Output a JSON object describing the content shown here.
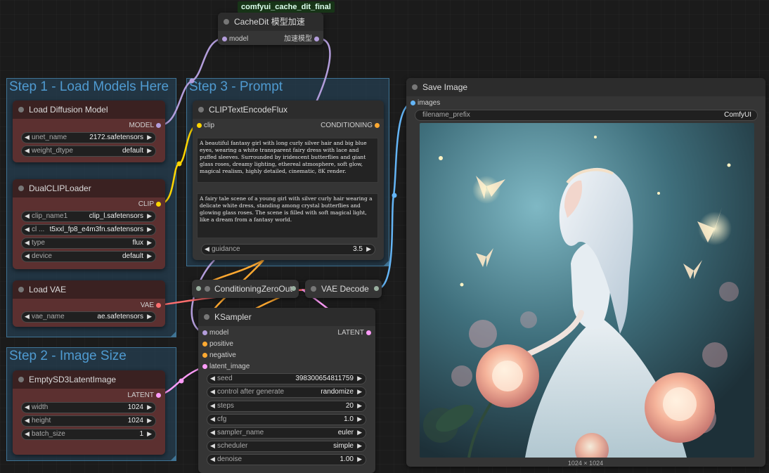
{
  "badge": "comfyui_cache_dit_final",
  "groups": {
    "step1": "Step 1 - Load Models Here",
    "step2": "Step 2 - Image Size",
    "step3": "Step 3 - Prompt"
  },
  "cachedit": {
    "title": "CacheDit 模型加速",
    "input": "model",
    "output": "加速模型"
  },
  "load_diffusion": {
    "title": "Load Diffusion Model",
    "output": "MODEL",
    "widgets": [
      {
        "label": "unet_name",
        "value": "2172.safetensors"
      },
      {
        "label": "weight_dtype",
        "value": "default"
      }
    ]
  },
  "dualclip": {
    "title": "DualCLIPLoader",
    "output": "CLIP",
    "widgets": [
      {
        "label": "clip_name1",
        "value": "clip_l.safetensors"
      },
      {
        "label": "cl ...",
        "value": "t5xxl_fp8_e4m3fn.safetensors"
      },
      {
        "label": "type",
        "value": "flux"
      },
      {
        "label": "device",
        "value": "default"
      }
    ]
  },
  "loadvae": {
    "title": "Load VAE",
    "output": "VAE",
    "widgets": [
      {
        "label": "vae_name",
        "value": "ae.safetensors"
      }
    ]
  },
  "emptylatent": {
    "title": "EmptySD3LatentImage",
    "output": "LATENT",
    "widgets": [
      {
        "label": "width",
        "value": "1024"
      },
      {
        "label": "height",
        "value": "1024"
      },
      {
        "label": "batch_size",
        "value": "1"
      }
    ]
  },
  "clipencode": {
    "title": "CLIPTextEncodeFlux",
    "input": "clip",
    "output": "CONDITIONING",
    "clip_l": "A beautiful fantasy girl with long curly silver hair and big blue eyes, wearing a white transparent fairy dress with lace and puffed sleeves. Surrounded by iridescent butterflies and giant glass roses, dreamy lighting, ethereal atmosphere, soft glow, magical realism, highly detailed, cinematic, 8K render.",
    "t5xxl": "A fairy tale scene of a young girl with silver curly hair wearing a delicate white dress, standing among crystal butterflies and glowing glass roses. The scene is filled with soft magical light, like a dream from a fantasy world.",
    "guidance_label": "guidance",
    "guidance_value": "3.5"
  },
  "condzero": {
    "title": "ConditioningZeroOut"
  },
  "vaedecode": {
    "title": "VAE Decode"
  },
  "ksampler": {
    "title": "KSampler",
    "inputs": [
      "model",
      "positive",
      "negative",
      "latent_image"
    ],
    "output": "LATENT",
    "widgets": [
      {
        "label": "seed",
        "value": "398300654811759"
      },
      {
        "label": "control after generate",
        "value": "randomize"
      },
      {
        "label": "steps",
        "value": "20"
      },
      {
        "label": "cfg",
        "value": "1.0"
      },
      {
        "label": "sampler_name",
        "value": "euler"
      },
      {
        "label": "scheduler",
        "value": "simple"
      },
      {
        "label": "denoise",
        "value": "1.00"
      }
    ]
  },
  "saveimage": {
    "title": "Save Image",
    "input": "images",
    "prefix_label": "filename_prefix",
    "prefix_value": "ComfyUI",
    "image_size": "1024 × 1024"
  },
  "colors": {
    "model": "#b39ddb",
    "clip": "#ffd500",
    "conditioning": "#ffa931",
    "vae": "#ff6e6e",
    "latent": "#ff9cf9",
    "image": "#64b5f6"
  }
}
